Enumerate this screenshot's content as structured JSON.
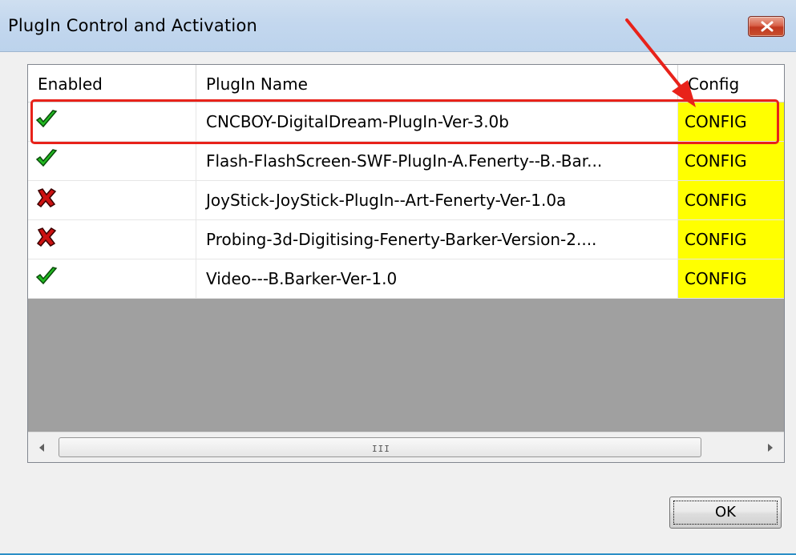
{
  "window": {
    "title": "PlugIn Control and Activation",
    "close_icon": "close-icon"
  },
  "table": {
    "headers": [
      "Enabled",
      "PlugIn Name",
      "Config"
    ],
    "rows": [
      {
        "enabled": true,
        "enabled_icon": "green-check-icon",
        "name": "CNCBOY-DigitalDream-PlugIn-Ver-3.0b",
        "config": "CONFIG"
      },
      {
        "enabled": true,
        "enabled_icon": "green-check-icon",
        "name": "Flash-FlashScreen-SWF-PlugIn-A.Fenerty--B.-Bar...",
        "config": "CONFIG"
      },
      {
        "enabled": false,
        "enabled_icon": "red-x-icon",
        "name": "JoyStick-JoyStick-PlugIn--Art-Fenerty-Ver-1.0a",
        "config": "CONFIG"
      },
      {
        "enabled": false,
        "enabled_icon": "red-x-icon",
        "name": "Probing-3d-Digitising-Fenerty-Barker-Version-2....",
        "config": "CONFIG"
      },
      {
        "enabled": true,
        "enabled_icon": "green-check-icon",
        "name": "Video---B.Barker-Ver-1.0",
        "config": "CONFIG"
      }
    ]
  },
  "scrollbar": {
    "grip": "III"
  },
  "buttons": {
    "ok_label": "OK"
  },
  "colors": {
    "config_bg": "#ffff00",
    "annotation": "#e8221a",
    "enabled": "#22bb22",
    "disabled": "#cc1111"
  }
}
